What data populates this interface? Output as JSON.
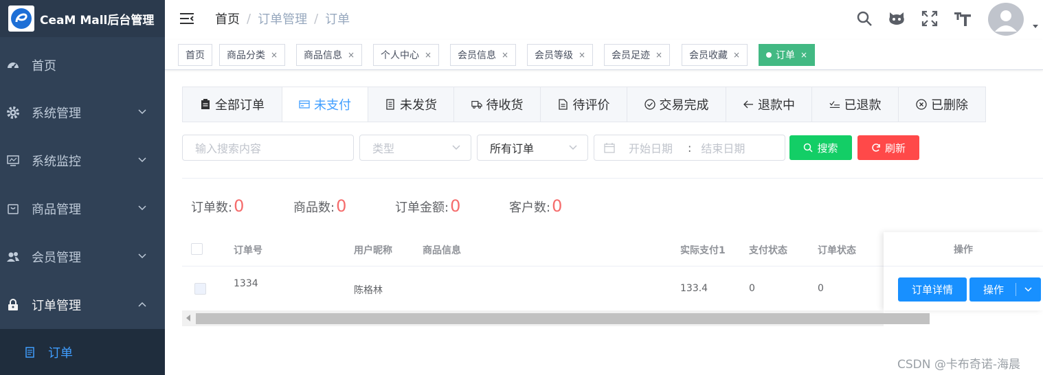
{
  "app": {
    "title": "CeaM Mall后台管理"
  },
  "sidebar": {
    "items": [
      {
        "label": "首页",
        "icon": "dashboard-icon"
      },
      {
        "label": "系统管理",
        "icon": "gear-icon"
      },
      {
        "label": "系统监控",
        "icon": "monitor-icon"
      },
      {
        "label": "商品管理",
        "icon": "shopping-icon"
      },
      {
        "label": "会员管理",
        "icon": "users-icon"
      },
      {
        "label": "订单管理",
        "icon": "lock-icon",
        "open": true
      }
    ],
    "submenu": {
      "label": "订单",
      "icon": "document-icon"
    }
  },
  "breadcrumb": {
    "home": "首页",
    "section": "订单管理",
    "current": "订单",
    "separator": "/"
  },
  "tags": [
    {
      "label": "首页",
      "closable": false
    },
    {
      "label": "商品分类",
      "closable": true
    },
    {
      "label": "商品信息",
      "closable": true
    },
    {
      "label": "个人中心",
      "closable": true
    },
    {
      "label": "会员信息",
      "closable": true
    },
    {
      "label": "会员等级",
      "closable": true
    },
    {
      "label": "会员足迹",
      "closable": true
    },
    {
      "label": "会员收藏",
      "closable": true
    },
    {
      "label": "订单",
      "closable": true,
      "active": true
    }
  ],
  "tag_close": "×",
  "order_tabs": [
    {
      "label": "全部订单",
      "icon": "clipboard-icon"
    },
    {
      "label": "未支付",
      "icon": "credit-card-icon",
      "active": true
    },
    {
      "label": "未发货",
      "icon": "receipt-icon"
    },
    {
      "label": "待收货",
      "icon": "truck-icon"
    },
    {
      "label": "待评价",
      "icon": "document-icon"
    },
    {
      "label": "交易完成",
      "icon": "check-circle-icon"
    },
    {
      "label": "退款中",
      "icon": "arrow-left-icon"
    },
    {
      "label": "已退款",
      "icon": "check-list-icon"
    },
    {
      "label": "已删除",
      "icon": "close-circle-icon"
    }
  ],
  "search": {
    "placeholder": "输入搜索内容",
    "type_placeholder": "类型",
    "order_filter": "所有订单",
    "start_date": "开始日期",
    "date_sep": ":",
    "end_date": "结束日期",
    "search_button": "搜索",
    "refresh_button": "刷新"
  },
  "stats": [
    {
      "label": "订单数",
      "value": "0"
    },
    {
      "label": "商品数",
      "value": "0"
    },
    {
      "label": "订单金额",
      "value": "0"
    },
    {
      "label": "客户数",
      "value": "0"
    }
  ],
  "stats_colon": ":",
  "table": {
    "headers": {
      "order_no": "订单号",
      "nickname": "用户昵称",
      "product": "商品信息",
      "paid": "实际支付1",
      "pay_status": "支付状态",
      "order_status": "订单状态",
      "actions": "操作"
    },
    "rows": [
      {
        "order_no": "1334",
        "nickname": "陈格林",
        "product": "",
        "paid": "133.4",
        "pay_status": "0",
        "order_status": "0"
      }
    ],
    "detail_button": "订单详情",
    "action_button": "操作"
  },
  "watermark": "CSDN @卡布奇诺-海晨",
  "colors": {
    "sidebar_bg": "#304156",
    "active_tag": "#42b983",
    "primary": "#1890ff",
    "search_button": "#13ce66",
    "refresh_button": "#ff4949",
    "stat_value": "#f56c6c"
  }
}
